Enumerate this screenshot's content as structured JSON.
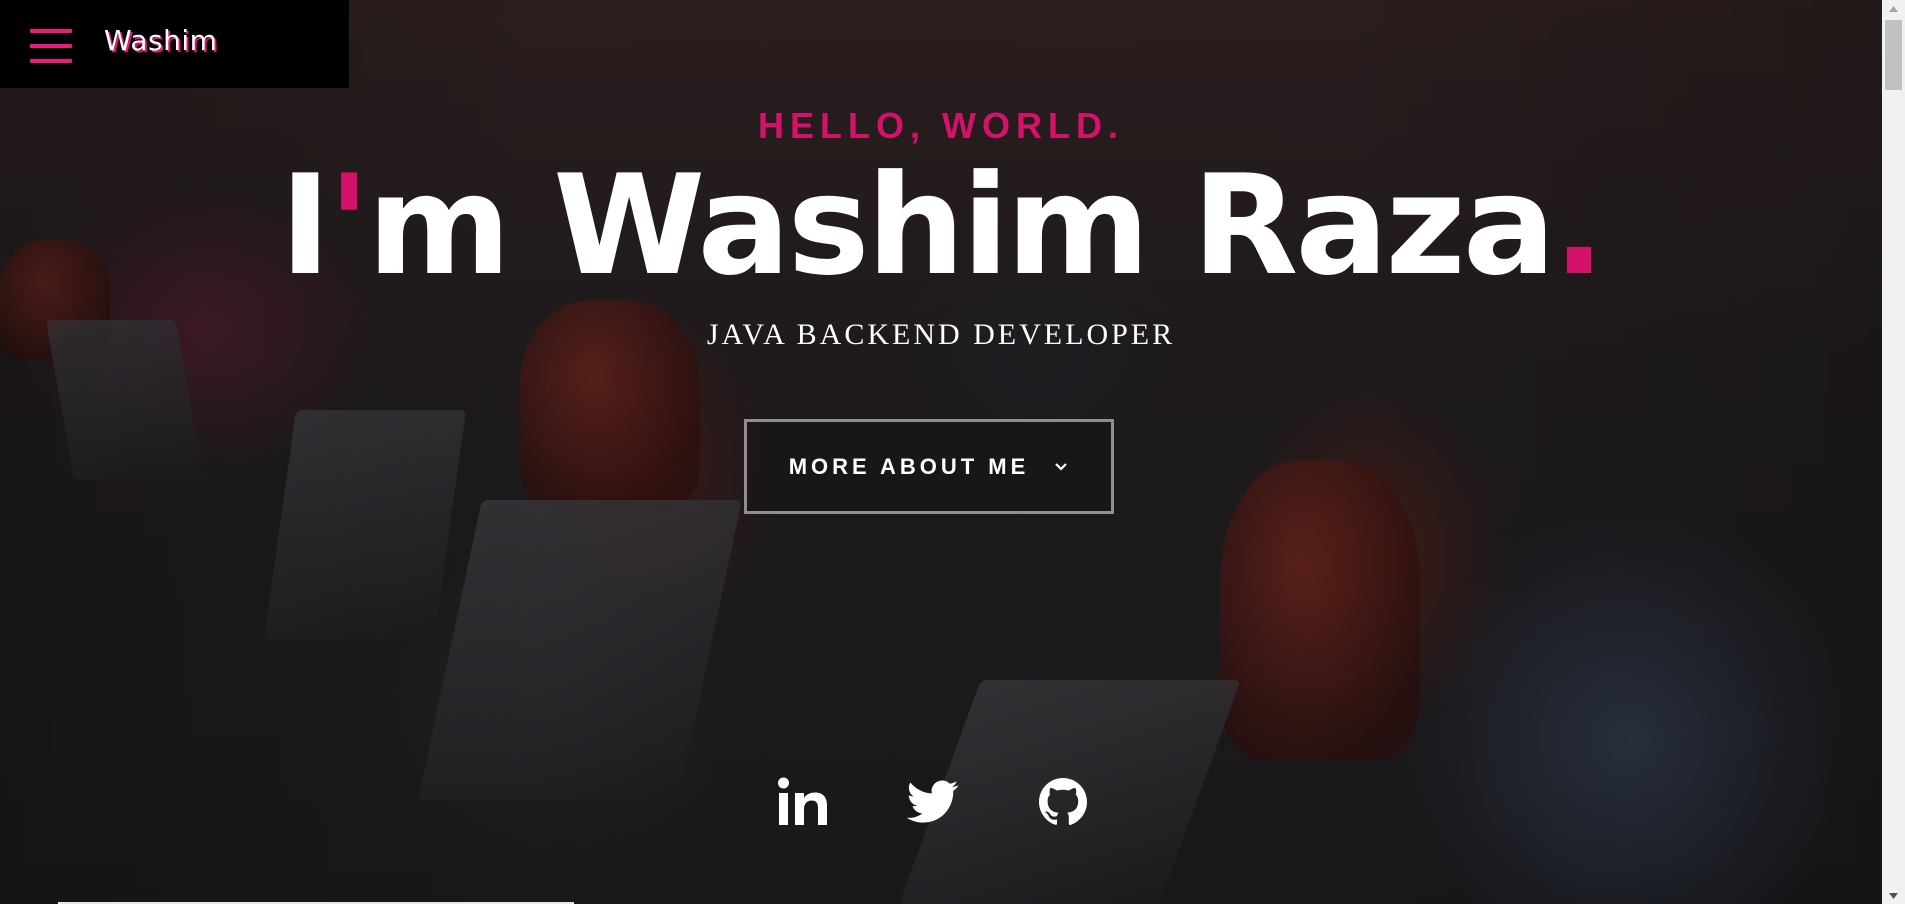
{
  "header": {
    "brand": "Washim",
    "menu_icon": "hamburger-icon"
  },
  "hero": {
    "greeting": "HELLO, WORLD.",
    "name_prefix": "I'm Washim Raza",
    "name_dot": ".",
    "role": "JAVA BACKEND DEVELOPER",
    "more_button": "MORE ABOUT ME"
  },
  "social": [
    {
      "name": "linkedin",
      "icon": "linkedin-icon"
    },
    {
      "name": "twitter",
      "icon": "twitter-icon"
    },
    {
      "name": "github",
      "icon": "github-icon"
    }
  ],
  "colors": {
    "accent": "#d4126b",
    "header_bg": "#000000",
    "text": "#ffffff"
  }
}
